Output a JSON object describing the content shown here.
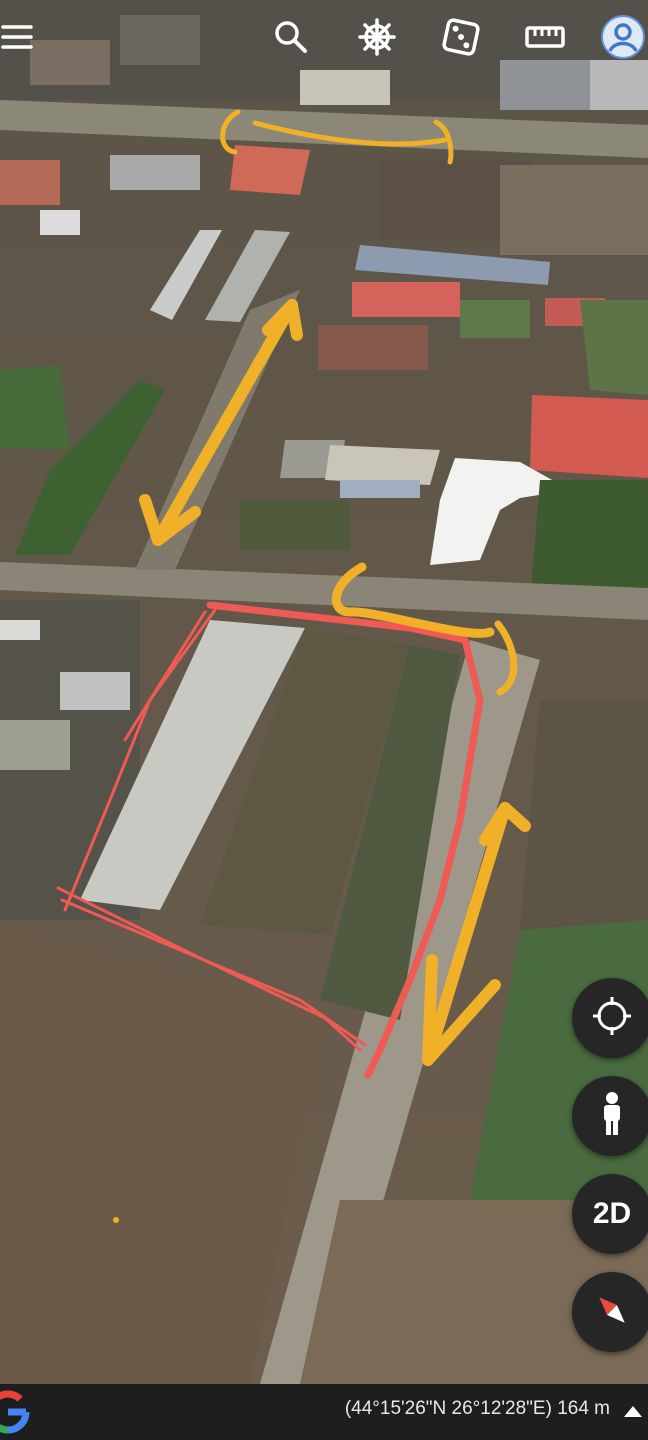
{
  "toolbar": {
    "icons": [
      "menu-icon",
      "search-icon",
      "voyager-icon",
      "dice-icon",
      "ruler-icon",
      "account-icon"
    ]
  },
  "map_controls": {
    "my_location_icon": "crosshair-icon",
    "street_view_icon": "pegman-icon",
    "view_mode_label": "2D",
    "compass_icon": "compass-icon"
  },
  "status_bar": {
    "coordinates_text": "(44°15'26\"N 26°12'28\"E) 164 m",
    "logo_icon": "google-g-icon",
    "expand_icon": "caret-up-icon"
  },
  "colors": {
    "annotation_red": "#ef5a55",
    "annotation_yellow": "#f0b128",
    "button_dark": "#262626",
    "bar_dark": "#1e1e1e"
  }
}
